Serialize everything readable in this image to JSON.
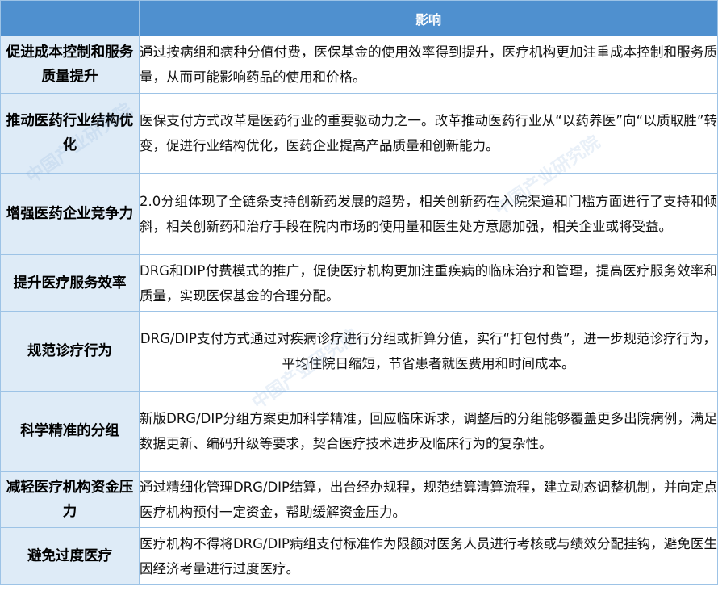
{
  "table": {
    "header": {
      "left": "",
      "right": "影响"
    },
    "rows": [
      {
        "label": "促进成本控制和服务质量提升",
        "content": "通过按病组和病种分值付费，医保基金的使用效率得到提升，医疗机构更加注重成本控制和服务质量，从而可能影响药品的使用和价格。"
      },
      {
        "label": "推动医药行业结构优化",
        "content": "医保支付方式改革是医药行业的重要驱动力之一。改革推动医药行业从“以药养医”向“以质取胜”转变，促进行业结构优化，医药企业提高产品质量和创新能力。"
      },
      {
        "label": "增强医药企业竞争力",
        "content": "2.0分组体现了全链条支持创新药发展的趋势，相关创新药在入院渠道和门槛方面进行了支持和倾斜，相关创新药和治疗手段在院内市场的使用量和医生处方意愿加强，相关企业或将受益。"
      },
      {
        "label": "提升医疗服务效率",
        "content": "DRG和DIP付费模式的推广，促使医疗机构更加注重疾病的临床治疗和管理，提高医疗服务效率和质量，实现医保基金的合理分配。"
      },
      {
        "label": "规范诊疗行为",
        "content": "DRG/DIP支付方式通过对疾病诊疗进行分组或折算分值，实行“打包付费”，进一步规范诊疗行为，平均住院日缩短，节省患者就医费用和时间成本。"
      },
      {
        "label": "科学精准的分组",
        "content": "新版DRG/DIP分组方案更加科学精准，回应临床诉求，调整后的分组能够覆盖更多出院病例，满足数据更新、编码升级等要求，契合医疗技术进步及临床行为的复杂性。"
      },
      {
        "label": "减轻医疗机构资金压力",
        "content": "通过精细化管理DRG/DIP结算，出台经办规程，规范结算清算流程，建立动态调整机制，并向定点医疗机构预付一定资金，帮助缓解资金压力。"
      },
      {
        "label": "避免过度医疗",
        "content": "医疗机构不得将DRG/DIP病组支付标准作为限额对医务人员进行考核或与绩效分配挂钩，避免医生因经济考量进行过度医疗。"
      }
    ]
  },
  "watermark": {
    "text": "中国产业研究院"
  }
}
